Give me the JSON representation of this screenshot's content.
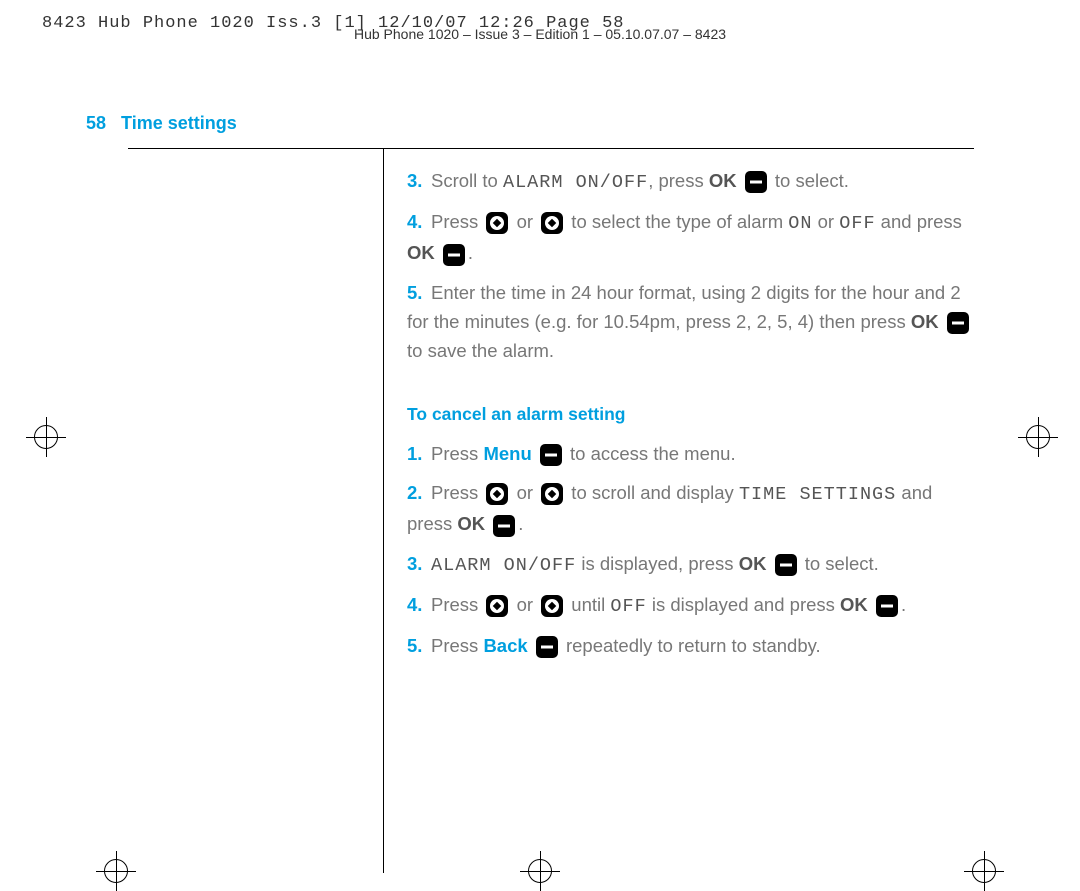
{
  "header_line1": "8423 Hub Phone 1020 Iss.3 [1]  12/10/07  12:26  Page 58",
  "header_line2": "Hub Phone 1020 – Issue 3 – Edition 1 – 05.10.07.07 – 8423",
  "page_number": "58",
  "section_title": "Time settings",
  "step3": {
    "n": "3.",
    "a": "Scroll to ",
    "lcd": "ALARM ON/OFF",
    "b": ", press ",
    "ok": "OK",
    "c": " to select."
  },
  "step4": {
    "n": "4.",
    "a": "Press ",
    "or": " or ",
    "b": " to select the type of alarm ",
    "on": "ON",
    "or2": " or ",
    "off": "OFF",
    "c": " and press ",
    "ok": "OK",
    "d": "."
  },
  "step5": {
    "n": "5.",
    "a": "Enter the time in 24 hour format, using 2 digits for the hour and 2 for the minutes (e.g. for 10.54pm, press 2, 2, 5, 4) then press ",
    "ok": "OK",
    "b": " to save the alarm."
  },
  "subheading": "To cancel an alarm setting",
  "c1": {
    "n": "1.",
    "a": "Press ",
    "menu": "Menu",
    "b": " to access the menu."
  },
  "c2": {
    "n": "2.",
    "a": "Press ",
    "or": " or ",
    "b": " to scroll and display ",
    "lcd": "TIME SETTINGS",
    "c": " and press ",
    "ok": "OK",
    "d": "."
  },
  "c3": {
    "n": "3.",
    "lcd": "ALARM ON/OFF",
    "a": " is displayed, press ",
    "ok": "OK",
    "b": " to select."
  },
  "c4": {
    "n": "4.",
    "a": "Press ",
    "or": " or ",
    "b": " until ",
    "off": "OFF",
    "c": " is displayed and press ",
    "ok": "OK",
    "d": "."
  },
  "c5": {
    "n": "5.",
    "a": "Press ",
    "back": "Back",
    "b": " repeatedly to return to standby."
  }
}
